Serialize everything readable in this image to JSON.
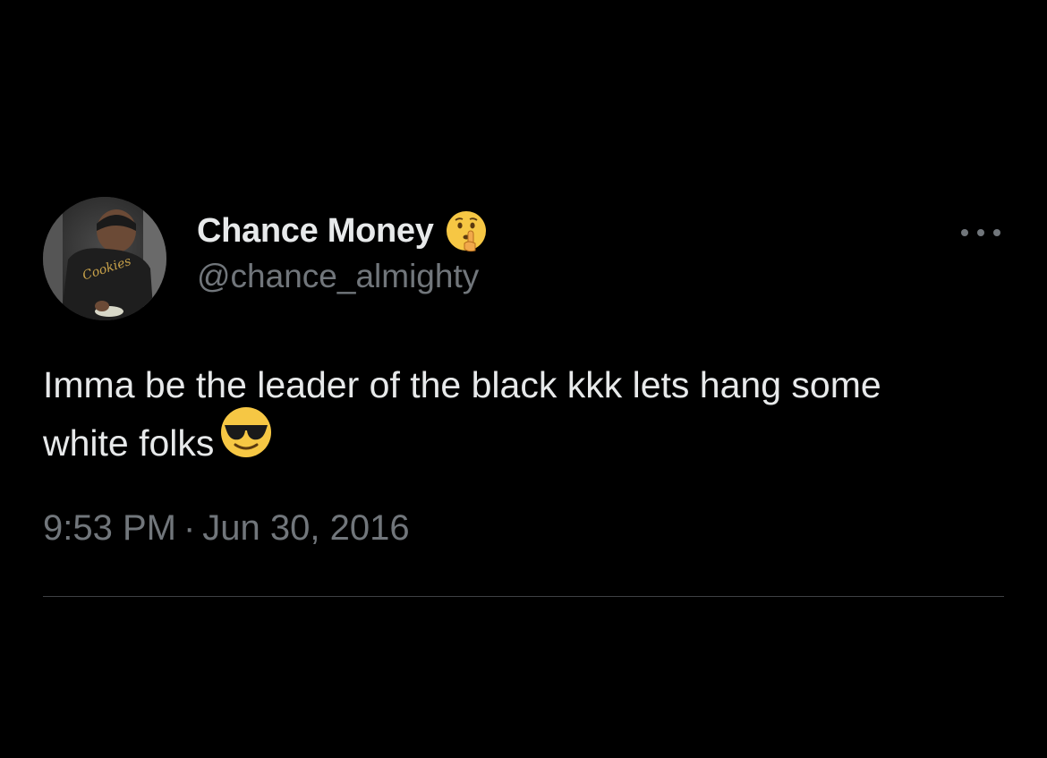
{
  "tweet": {
    "display_name": "Chance Money",
    "name_emoji_icon": "shushing-face-emoji-icon",
    "handle": "@chance_almighty",
    "text": "Imma be the leader of the black kkk lets hang some white folks",
    "text_emoji_icon": "sunglasses-face-emoji-icon",
    "time": "9:53 PM",
    "separator": "·",
    "date": "Jun 30, 2016",
    "more_icon": "more-options-icon"
  },
  "colors": {
    "background": "#000000",
    "primary_text": "#e7e9ea",
    "secondary_text": "#71767b",
    "divider": "#3e4144"
  }
}
